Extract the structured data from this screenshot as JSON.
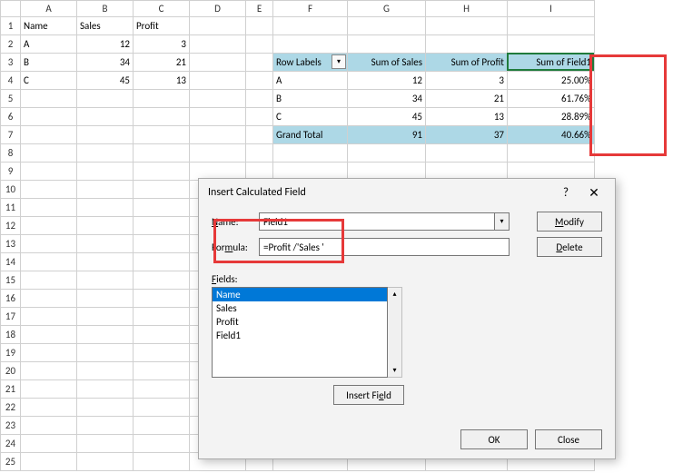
{
  "columns": [
    "A",
    "B",
    "C",
    "D",
    "E",
    "F",
    "G",
    "H",
    "I"
  ],
  "rowCount": 25,
  "activeColumn": "I",
  "sourceHeaders": {
    "a": "Name",
    "b": "Sales",
    "c": "Profit"
  },
  "sourceRows": [
    {
      "a": "A",
      "b": 12,
      "c": 3
    },
    {
      "a": "B",
      "b": 34,
      "c": 21
    },
    {
      "a": "C",
      "b": 45,
      "c": 13
    }
  ],
  "pivot": {
    "rowLabelsHeader": "Row Labels",
    "col1": "Sum of Sales",
    "col2": "Sum of Profit",
    "col3": "Sum of Field1",
    "rows": [
      {
        "label": "A",
        "sales": 12,
        "profit": 3,
        "pct": "25.00%"
      },
      {
        "label": "B",
        "sales": 34,
        "profit": 21,
        "pct": "61.76%"
      },
      {
        "label": "C",
        "sales": 45,
        "profit": 13,
        "pct": "28.89%"
      }
    ],
    "grand": {
      "label": "Grand Total",
      "sales": 91,
      "profit": 37,
      "pct": "40.66%"
    }
  },
  "dialog": {
    "title": "Insert Calculated Field",
    "help": "?",
    "closeGlyph": "✕",
    "nameLabel": "Name:",
    "nameValue": "Field1",
    "formulaLabel": "Formula:",
    "formulaValue": "=Profit /'Sales '",
    "modify": "Modify",
    "delete": "Delete",
    "fieldsLabel": "Fields:",
    "fields": [
      "Name",
      "Sales",
      "Profit",
      "Field1"
    ],
    "insertField": "Insert Field",
    "ok": "OK",
    "close": "Close",
    "dropdownGlyph": "▾",
    "upGlyph": "▴",
    "downGlyph": "▾"
  }
}
